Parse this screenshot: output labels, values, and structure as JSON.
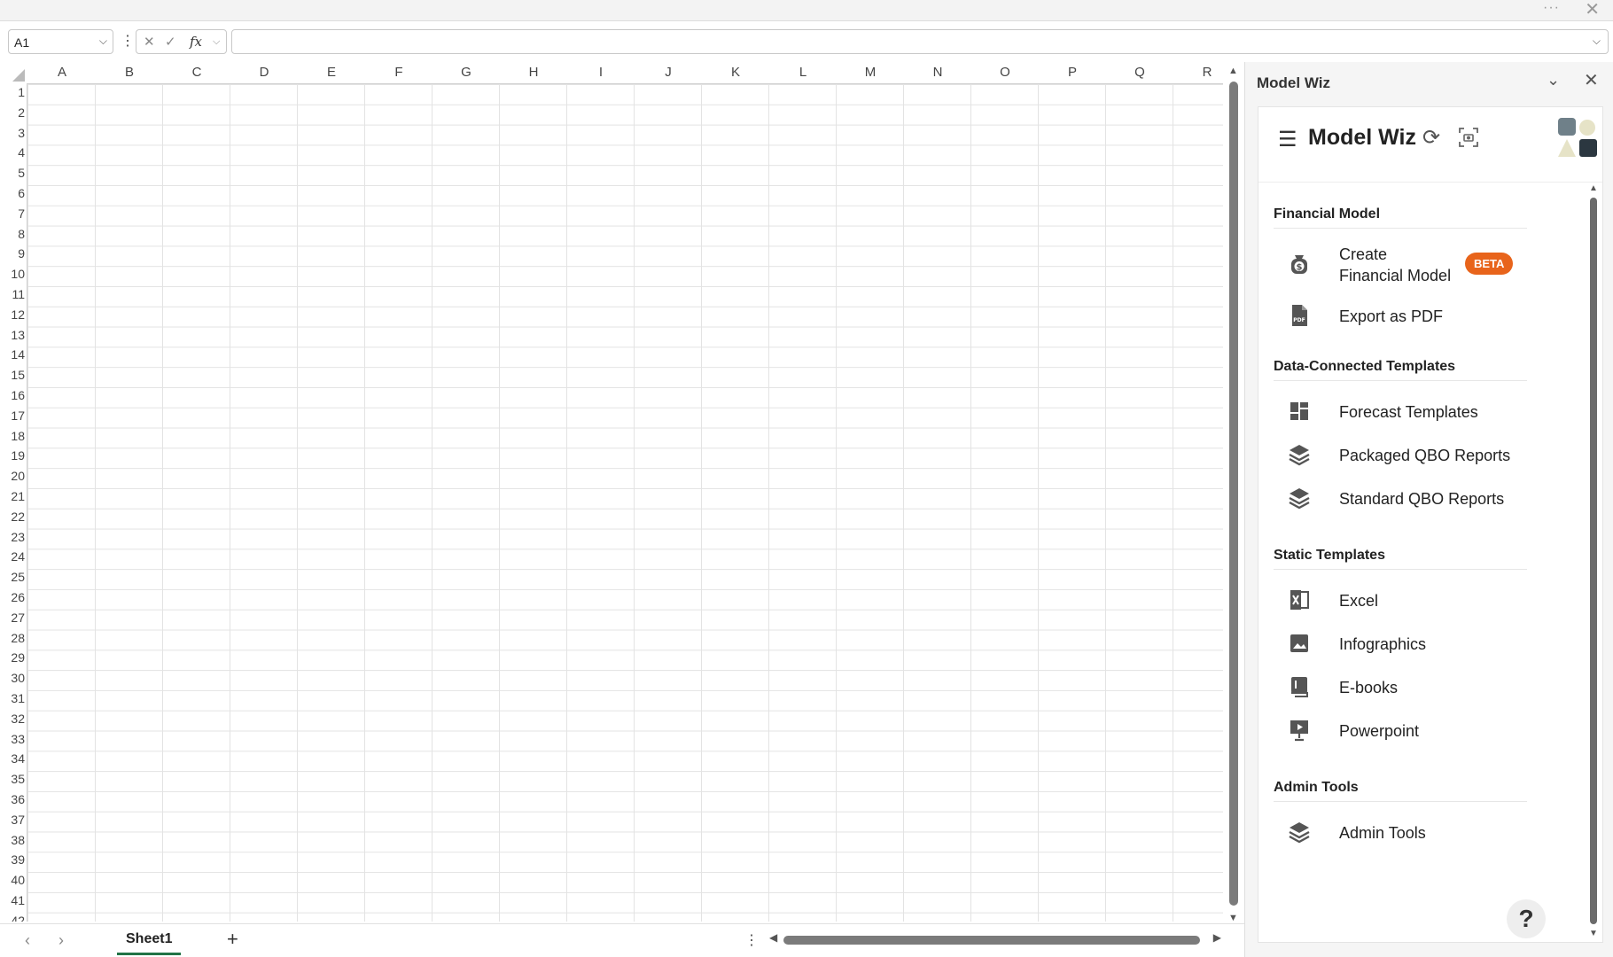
{
  "window": {
    "more_label": "···",
    "close_label": "✕"
  },
  "formula_bar": {
    "name_box": "A1",
    "more_label": "⋮",
    "cancel": "✕",
    "enter": "✓",
    "fx": "fx",
    "formula": ""
  },
  "grid": {
    "columns": [
      "A",
      "B",
      "C",
      "D",
      "E",
      "F",
      "G",
      "H",
      "I",
      "J",
      "K",
      "L",
      "M",
      "N",
      "O",
      "P",
      "Q",
      "R"
    ],
    "rows": [
      "1",
      "2",
      "3",
      "4",
      "5",
      "6",
      "7",
      "8",
      "9",
      "10",
      "11",
      "12",
      "13",
      "14",
      "15",
      "16",
      "17",
      "18",
      "19",
      "20",
      "21",
      "22",
      "23",
      "24",
      "25",
      "26",
      "27",
      "28",
      "29",
      "30",
      "31",
      "32",
      "33",
      "34",
      "35",
      "36",
      "37",
      "38",
      "39",
      "40",
      "41",
      "42"
    ]
  },
  "sheets": {
    "prev": "‹",
    "next": "›",
    "active": "Sheet1",
    "add": "+",
    "more": "⋮"
  },
  "pane": {
    "title": "Model Wiz",
    "addin_title": "Model Wiz",
    "sections": [
      {
        "title": "Financial Model",
        "items": [
          {
            "label_line1": "Create",
            "label_line2": "Financial Model",
            "icon": "money-bag-icon",
            "badge": "BETA"
          },
          {
            "label": "Export as PDF",
            "icon": "pdf-file-icon"
          }
        ]
      },
      {
        "title": "Data-Connected Templates",
        "items": [
          {
            "label": "Forecast Templates",
            "icon": "dashboard-icon"
          },
          {
            "label": "Packaged QBO Reports",
            "icon": "layers-icon"
          },
          {
            "label": "Standard QBO Reports",
            "icon": "layers-icon"
          }
        ]
      },
      {
        "title": "Static Templates",
        "items": [
          {
            "label": "Excel",
            "icon": "excel-icon"
          },
          {
            "label": "Infographics",
            "icon": "image-icon"
          },
          {
            "label": "E-books",
            "icon": "book-icon"
          },
          {
            "label": "Powerpoint",
            "icon": "presentation-icon"
          }
        ]
      },
      {
        "title": "Admin Tools",
        "items": [
          {
            "label": "Admin Tools",
            "icon": "layers-icon"
          }
        ]
      }
    ],
    "help": "?"
  },
  "colors": {
    "accent_green": "#217346",
    "beta": "#e8641b",
    "icon_gray": "#555555"
  }
}
